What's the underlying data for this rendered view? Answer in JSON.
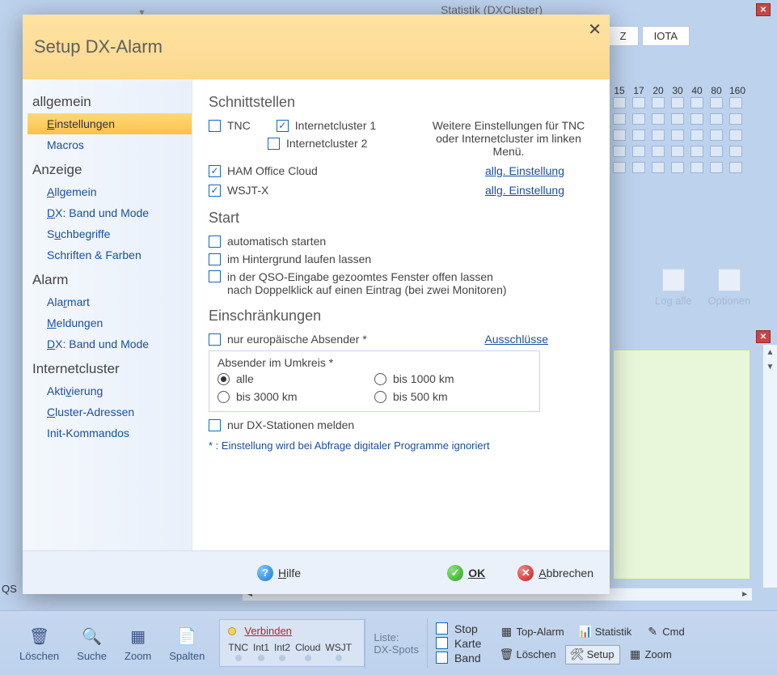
{
  "bg": {
    "title": "Statistik (DXCluster)",
    "tab1": "Z",
    "tab2": "IOTA",
    "bands": [
      "15",
      "17",
      "20",
      "30",
      "40",
      "80",
      "160"
    ],
    "btn_logalle": "Log alle",
    "btn_optionen": "Optionen",
    "qs_label": "QS"
  },
  "dialog": {
    "title": "Setup DX-Alarm",
    "close_glyph": "✕"
  },
  "sidebar": {
    "sec_allgemein": "allgemein",
    "item_einstellungen": "Einstellungen",
    "item_einstellungen_ul": "E",
    "item_macros": "Macros",
    "sec_anzeige": "Anzeige",
    "item_allgemein": "Allgemein",
    "item_allgemein_ul": "A",
    "item_dx_band_mode": "DX: Band und Mode",
    "item_dx_ul": "D",
    "item_suchbegriffe": "Suchbegriffe",
    "item_such_ul": "u",
    "item_schriften": "Schriften & Farben",
    "sec_alarm": "Alarm",
    "item_alarmart": "Alarmart",
    "item_alarmart_ul": "r",
    "item_meldungen": "Meldungen",
    "item_meldungen_ul": "M",
    "sec_internet": "Internetcluster",
    "item_aktivierung": "Aktivierung",
    "item_aktivierung_ul": "v",
    "item_cluster_adr": "Cluster-Adressen",
    "item_cluster_ul": "C",
    "item_init": "Init-Kommandos"
  },
  "content": {
    "h_schnittstellen": "Schnittstellen",
    "cb_tnc": "TNC",
    "cb_int1": "Internetcluster 1",
    "cb_int2": "Internetcluster 2",
    "note": "Weitere Einstellungen für TNC oder Internetcluster im linken Menü.",
    "cb_hamcloud": "HAM Office Cloud",
    "cb_wsjt": "WSJT-X",
    "link_allg": "allg. Einstellung",
    "h_start": "Start",
    "cb_autostart": "automatisch starten",
    "cb_hintergrund": "im Hintergrund laufen lassen",
    "cb_qso_line1": "in der QSO-Eingabe gezoomtes Fenster offen lassen",
    "cb_qso_line2": "nach Doppelklick auf einen Eintrag (bei zwei Monitoren)",
    "h_einschr": "Einschränkungen",
    "cb_eur": "nur europäische Absender *",
    "link_aus": "Ausschlüsse",
    "fs_legend": "Absender im Umkreis *",
    "rad_alle": "alle",
    "rad_1000": "bis 1000 km",
    "rad_3000": "bis 3000 km",
    "rad_500": "bis 500 km",
    "cb_dxonly": "nur DX-Stationen melden",
    "footnote": "* : Einstellung wird bei Abfrage digitaler Programme  ignoriert"
  },
  "footer": {
    "hilfe": "Hilfe",
    "hilfe_ul": "H",
    "ok": "OK",
    "ok_ul": "O",
    "abbrechen": "Abbrechen",
    "abbrechen_ul": "A"
  },
  "bottombar": {
    "loeschen": "Löschen",
    "suche": "Suche",
    "zoom": "Zoom",
    "spalten": "Spalten",
    "verbinden": "Verbinden",
    "tnc": "TNC",
    "int1": "Int1",
    "int2": "Int2",
    "cloud": "Cloud",
    "wsjt": "WSJT",
    "liste": "Liste:",
    "dxspots": "DX-Spots",
    "stop": "Stop",
    "karte": "Karte",
    "band": "Band",
    "topalarm": "Top-Alarm",
    "statistik": "Statistik",
    "cmd": "Cmd",
    "loeschen2": "Löschen",
    "setup": "Setup",
    "zoom2": "Zoom"
  }
}
